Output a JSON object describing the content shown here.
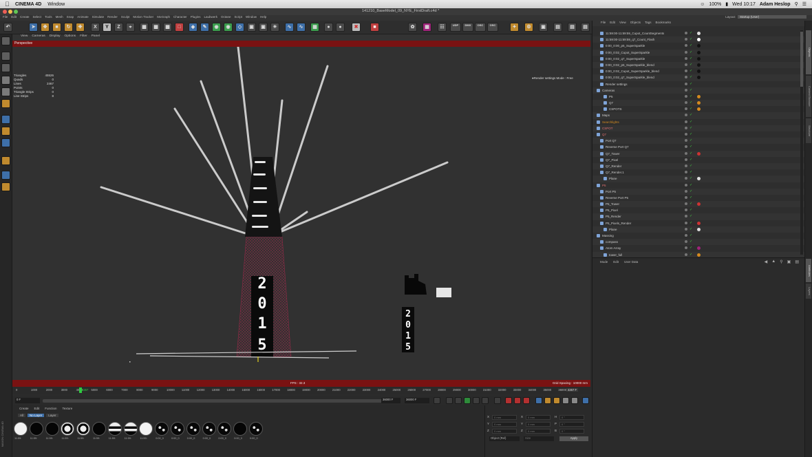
{
  "mac_menubar": {
    "app_name": "CINEMA 4D",
    "menus": [
      "Window"
    ],
    "clock": "Wed 10:17",
    "user": "Adam Heslop",
    "battery": "100%"
  },
  "window": {
    "title": "141210_BaseModel_09_NYE_FirstDraft.c4d *"
  },
  "menubar": {
    "items": [
      "File",
      "Edit",
      "Create",
      "Select",
      "Tools",
      "Mesh",
      "Snap",
      "Animate",
      "Simulate",
      "Render",
      "Sculpt",
      "Motion Tracker",
      "MoGraph",
      "Character",
      "Plugins",
      "Laubwerk",
      "Octane",
      "Script",
      "Window",
      "Help"
    ],
    "layout_label": "Layout:",
    "layout_value": "Startup (User)"
  },
  "toolbar": {
    "axis_buttons": [
      "X",
      "Y",
      "Z"
    ],
    "plugin_buttons": [
      "UDP",
      "DMX",
      "OSC",
      "OSC"
    ]
  },
  "viewport": {
    "menu": [
      "View",
      "Cameras",
      "Display",
      "Options",
      "Filter",
      "Panel"
    ],
    "label": "Perspective",
    "stats": [
      {
        "label": "Triangles",
        "value": "45526"
      },
      {
        "label": "Quads",
        "value": "0"
      },
      {
        "label": "Lines",
        "value": "2467"
      },
      {
        "label": "Points",
        "value": "0"
      },
      {
        "label": "Triangle Strips",
        "value": "0"
      },
      {
        "label": "Line Strips",
        "value": "8"
      }
    ],
    "render_mode": "●Render settings Mode : Free",
    "fps": "FPS : 32.3",
    "grid_spacing": "Grid Spacing : 10000 mm",
    "year_big": [
      "2",
      "0",
      "1",
      "5"
    ],
    "year_small": [
      "2",
      "0",
      "1",
      "5"
    ]
  },
  "timeline": {
    "ticks": [
      "0",
      "1000",
      "2000",
      "3000",
      "4000",
      "5000",
      "6000",
      "7000",
      "8000",
      "9000",
      "10000",
      "11000",
      "12000",
      "13000",
      "14000",
      "15000",
      "16000",
      "17000",
      "18000",
      "19000",
      "20000",
      "21000",
      "22000",
      "23000",
      "24000",
      "25000",
      "26000",
      "27000",
      "28000",
      "29000",
      "30000",
      "31000",
      "32000",
      "33000",
      "34000",
      "35000",
      "36000"
    ],
    "current_frame": "4267",
    "current_field": "4267 F",
    "start_field": "0 F",
    "end_field": "36000 F",
    "max_field": "36000 F"
  },
  "material_manager": {
    "menu": [
      "Create",
      "Edit",
      "Function",
      "Texture"
    ],
    "tabs": [
      "All",
      "No Layer",
      "Layer"
    ],
    "materials": [
      {
        "label": "11:59:",
        "type": "white"
      },
      {
        "label": "11:59:",
        "type": "black"
      },
      {
        "label": "11:59:",
        "type": "black"
      },
      {
        "label": "11:59:",
        "type": "ring"
      },
      {
        "label": "11:59:",
        "type": "ring"
      },
      {
        "label": "11:59:",
        "type": "black"
      },
      {
        "label": "11:59:",
        "type": "split"
      },
      {
        "label": "11:59:",
        "type": "split"
      },
      {
        "label": "11:59:",
        "type": "white"
      },
      {
        "label": "0:00_0",
        "type": "dots"
      },
      {
        "label": "0:00_0",
        "type": "dots"
      },
      {
        "label": "0:00_0",
        "type": "dots"
      },
      {
        "label": "0:00_0",
        "type": "dots"
      },
      {
        "label": "0:00_0",
        "type": "dots"
      },
      {
        "label": "0:00_0",
        "type": "black"
      },
      {
        "label": "0:00_0",
        "type": "dots"
      }
    ]
  },
  "coordinates": {
    "labels": [
      "X",
      "Y",
      "Z",
      "X",
      "Y",
      "Z",
      "H",
      "P",
      "B"
    ],
    "values": [
      "0 mm",
      "0 mm",
      "0 mm",
      "0 mm",
      "0 mm",
      "0 mm",
      "0 °",
      "0 °",
      "0 °"
    ],
    "mode_select": "Object (Rel)",
    "size_select": "Size",
    "apply_label": "Apply"
  },
  "object_manager": {
    "menu": [
      "File",
      "Edit",
      "View",
      "Objects",
      "Tags",
      "Bookmarks"
    ],
    "objects": [
      {
        "name": "11:59:00-11:59:59_Cupot_CountSegments",
        "indent": 1,
        "color": "#ccc",
        "tag": "#ddd"
      },
      {
        "name": "11:59:00-11:59:59_q7_Count_Flash",
        "indent": 1,
        "color": "#ccc",
        "tag": "#fff"
      },
      {
        "name": "0:00_0:00_p5_SuperSparkle",
        "indent": 1,
        "color": "#ccc",
        "tag": "#111"
      },
      {
        "name": "0:00_0:02_Cupot_SuperSparkle",
        "indent": 1,
        "color": "#ccc",
        "tag": "#111"
      },
      {
        "name": "0:00_0:02_q7_SuperSparkle",
        "indent": 1,
        "color": "#ccc",
        "tag": "#111"
      },
      {
        "name": "0:00_0:02_p5_SuperSparkle_blend",
        "indent": 1,
        "color": "#ccc",
        "tag": "#111"
      },
      {
        "name": "0:00_0:02_Cupot_SuperSparkle_blend",
        "indent": 1,
        "color": "#ccc",
        "tag": "#111"
      },
      {
        "name": "0:00_0:02_q7_SuperSparkle_blend",
        "indent": 1,
        "color": "#ccc",
        "tag": "#111"
      },
      {
        "name": "Render settings",
        "indent": 1,
        "color": "#ccc",
        "tag": ""
      },
      {
        "name": "Cameras",
        "indent": 0,
        "color": "#ccc",
        "tag": ""
      },
      {
        "name": "P5",
        "indent": 2,
        "color": "#ccc",
        "tag": "#d48a1e"
      },
      {
        "name": "Q7",
        "indent": 2,
        "color": "#ccc",
        "tag": "#d48a1e"
      },
      {
        "name": "CSPOTS",
        "indent": 2,
        "color": "#ccc",
        "tag": "#d48a1e"
      },
      {
        "name": "Maps",
        "indent": 0,
        "color": "#ccc",
        "tag": ""
      },
      {
        "name": "Searchlights",
        "indent": 0,
        "color": "#d48a1e",
        "tag": ""
      },
      {
        "name": "CSPOT",
        "indent": 0,
        "color": "#e07070",
        "tag": ""
      },
      {
        "name": "Q7",
        "indent": 0,
        "color": "#e07070",
        "tag": ""
      },
      {
        "name": "Port Q7",
        "indent": 1,
        "color": "#ccc",
        "tag": ""
      },
      {
        "name": "Reverse Port Q7",
        "indent": 1,
        "color": "#ccc",
        "tag": ""
      },
      {
        "name": "Q7_Tower",
        "indent": 1,
        "color": "#ccc",
        "tag": "#c33"
      },
      {
        "name": "Q7_Pixel",
        "indent": 1,
        "color": "#ccc",
        "tag": ""
      },
      {
        "name": "Q7_Render",
        "indent": 1,
        "color": "#ccc",
        "tag": ""
      },
      {
        "name": "Q7_Render.1",
        "indent": 1,
        "color": "#ccc",
        "tag": ""
      },
      {
        "name": "Plane",
        "indent": 2,
        "color": "#ccc",
        "tag": "#ddd"
      },
      {
        "name": "P5",
        "indent": 0,
        "color": "#e07070",
        "tag": ""
      },
      {
        "name": "Port P5",
        "indent": 1,
        "color": "#ccc",
        "tag": ""
      },
      {
        "name": "Reverse Port P5",
        "indent": 1,
        "color": "#ccc",
        "tag": ""
      },
      {
        "name": "P5_Tower",
        "indent": 1,
        "color": "#ccc",
        "tag": "#c33"
      },
      {
        "name": "P5_Pixel",
        "indent": 1,
        "color": "#ccc",
        "tag": ""
      },
      {
        "name": "P5_Render",
        "indent": 1,
        "color": "#ccc",
        "tag": ""
      },
      {
        "name": "P5_Pixels_Render",
        "indent": 1,
        "color": "#ccc",
        "tag": "#c33"
      },
      {
        "name": "Plane",
        "indent": 2,
        "color": "#ccc",
        "tag": "#ddd"
      },
      {
        "name": "Massing",
        "indent": 0,
        "color": "#ccc",
        "tag": ""
      },
      {
        "name": "compass",
        "indent": 1,
        "color": "#ccc",
        "tag": ""
      },
      {
        "name": "Atom Array",
        "indent": 1,
        "color": "#ccc",
        "tag": "#a0237a"
      },
      {
        "name": "tower_full",
        "indent": 2,
        "color": "#ccc",
        "tag": "#d48a1e"
      }
    ]
  },
  "attribute_manager": {
    "menu": [
      "Mode",
      "Edit",
      "User Data"
    ]
  },
  "side_tabs": [
    "Objects",
    "Content Browser",
    "Structure",
    "Attributes",
    "Layers"
  ],
  "maxon_logo": "MAXON CINEMA 4D"
}
